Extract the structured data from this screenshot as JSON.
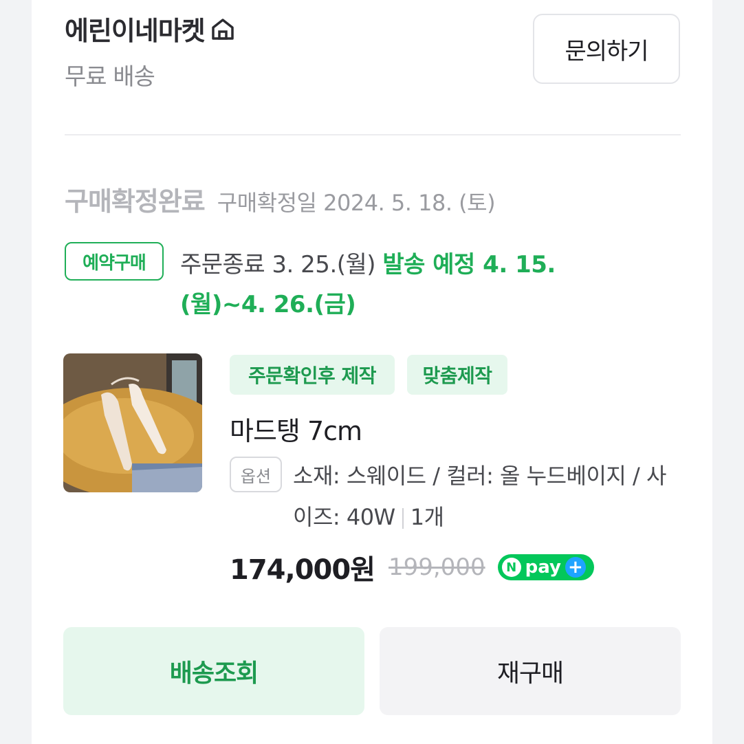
{
  "store": {
    "name": "에린이네마켓",
    "shipping": "무료 배송",
    "inquiry_label": "문의하기"
  },
  "status": {
    "title": "구매확정완료",
    "date": "구매확정일 2024. 5. 18. (토)"
  },
  "reservation": {
    "badge": "예약구매",
    "order_end": "주문종료 3. 25.(월)",
    "ship_schedule": "발송 예정 4. 15.(월)~4. 26.(금)"
  },
  "product": {
    "tags": [
      "주문확인후 제작",
      "맞춤제작"
    ],
    "name": "마드탱 7cm",
    "option_badge": "옵션",
    "option_text": "소재: 스웨이드 / 컬러: 올 누드베이지 / 사이즈: 40W",
    "quantity": "1개",
    "price": "174,000원",
    "original_price": "199,000",
    "npay_label": "pay"
  },
  "actions": {
    "track_label": "배송조회",
    "rebuy_label": "재구매"
  },
  "colors": {
    "accent_green": "#1fae57",
    "npay_green": "#03c75a"
  }
}
